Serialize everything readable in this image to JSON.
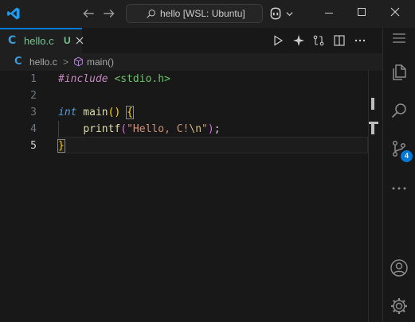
{
  "titlebar": {
    "search_text": "hello [WSL: Ubuntu]"
  },
  "tab": {
    "name": "hello.c",
    "badge": "U",
    "icon_letter": "C"
  },
  "breadcrumb": {
    "file": "hello.c",
    "separator": ">",
    "symbol": "main()",
    "icon_letter": "C"
  },
  "editor": {
    "line_numbers": [
      "1",
      "2",
      "3",
      "4",
      "5"
    ],
    "current_line": 5,
    "lines": {
      "l1": {
        "directive": "#include",
        "header": " <stdio.h>"
      },
      "l3": {
        "type": "int",
        "name": " main",
        "paren_open": "(",
        "paren_close": ")",
        "space": " ",
        "brace_open": "{"
      },
      "l4": {
        "indent": "    ",
        "call": "printf",
        "paren_open": "(",
        "string": "\"Hello, C!",
        "escape": "\\n",
        "quote": "\"",
        "paren_close": ")",
        "semicolon": ";"
      },
      "l5": {
        "brace_close": "}"
      }
    }
  },
  "activity": {
    "source_control_badge": "4"
  },
  "colors": {
    "accent": "#0078d4",
    "tab_modified": "#73c991",
    "c_icon": "#3c9ad6"
  },
  "icons": [
    "vscode-logo-icon",
    "arrow-left-icon",
    "arrow-right-icon",
    "search-icon",
    "copilot-icon",
    "chevron-down-icon",
    "minimize-icon",
    "maximize-icon",
    "close-icon",
    "run-icon",
    "sparkle-icon",
    "compare-changes-icon",
    "split-editor-icon",
    "more-actions-icon",
    "menu-icon",
    "explorer-icon",
    "source-control-icon",
    "extensions-more-icon",
    "account-icon",
    "settings-gear-icon",
    "symbol-method-icon"
  ]
}
